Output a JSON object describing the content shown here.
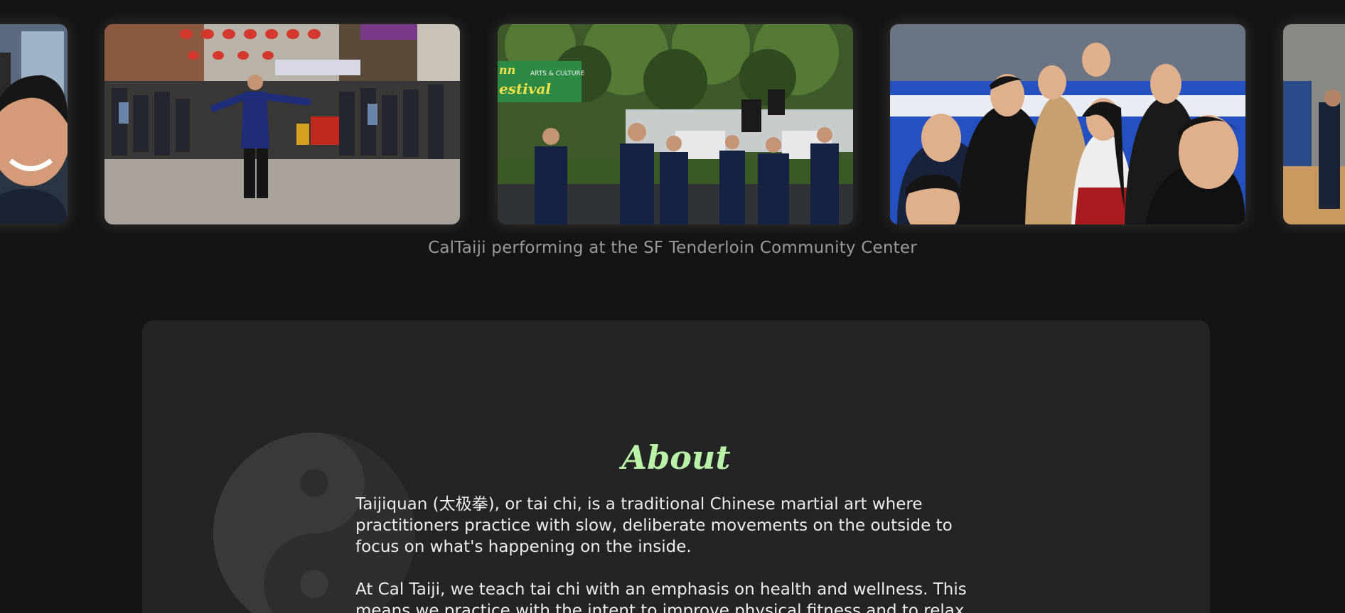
{
  "carousel": {
    "caption": "CalTaiji performing at the SF Tenderloin Community Center",
    "slides": [
      {
        "subject": "selfie-partial"
      },
      {
        "subject": "street-performance"
      },
      {
        "subject": "outdoor-festival"
      },
      {
        "subject": "group-selfie"
      },
      {
        "subject": "gym-partial"
      }
    ],
    "festival_banner": {
      "line1": "ARTS & CULTURE",
      "line2": "estival",
      "line0": "nn"
    }
  },
  "about": {
    "title": "About",
    "paragraphs": [
      "Taijiquan (太极拳), or tai chi, is a traditional Chinese martial art where practitioners practice with slow, deliberate movements on the outside to focus on what's happening on the inside.",
      "At Cal Taiji, we teach tai chi with an emphasis on health and wellness. This means we practice with the intent to improve physical fitness and to relax."
    ]
  },
  "colors": {
    "background": "#141414",
    "card": "#242424",
    "title": "#b9f2a8",
    "caption": "#9a9a9a",
    "body_text": "#ececec"
  }
}
